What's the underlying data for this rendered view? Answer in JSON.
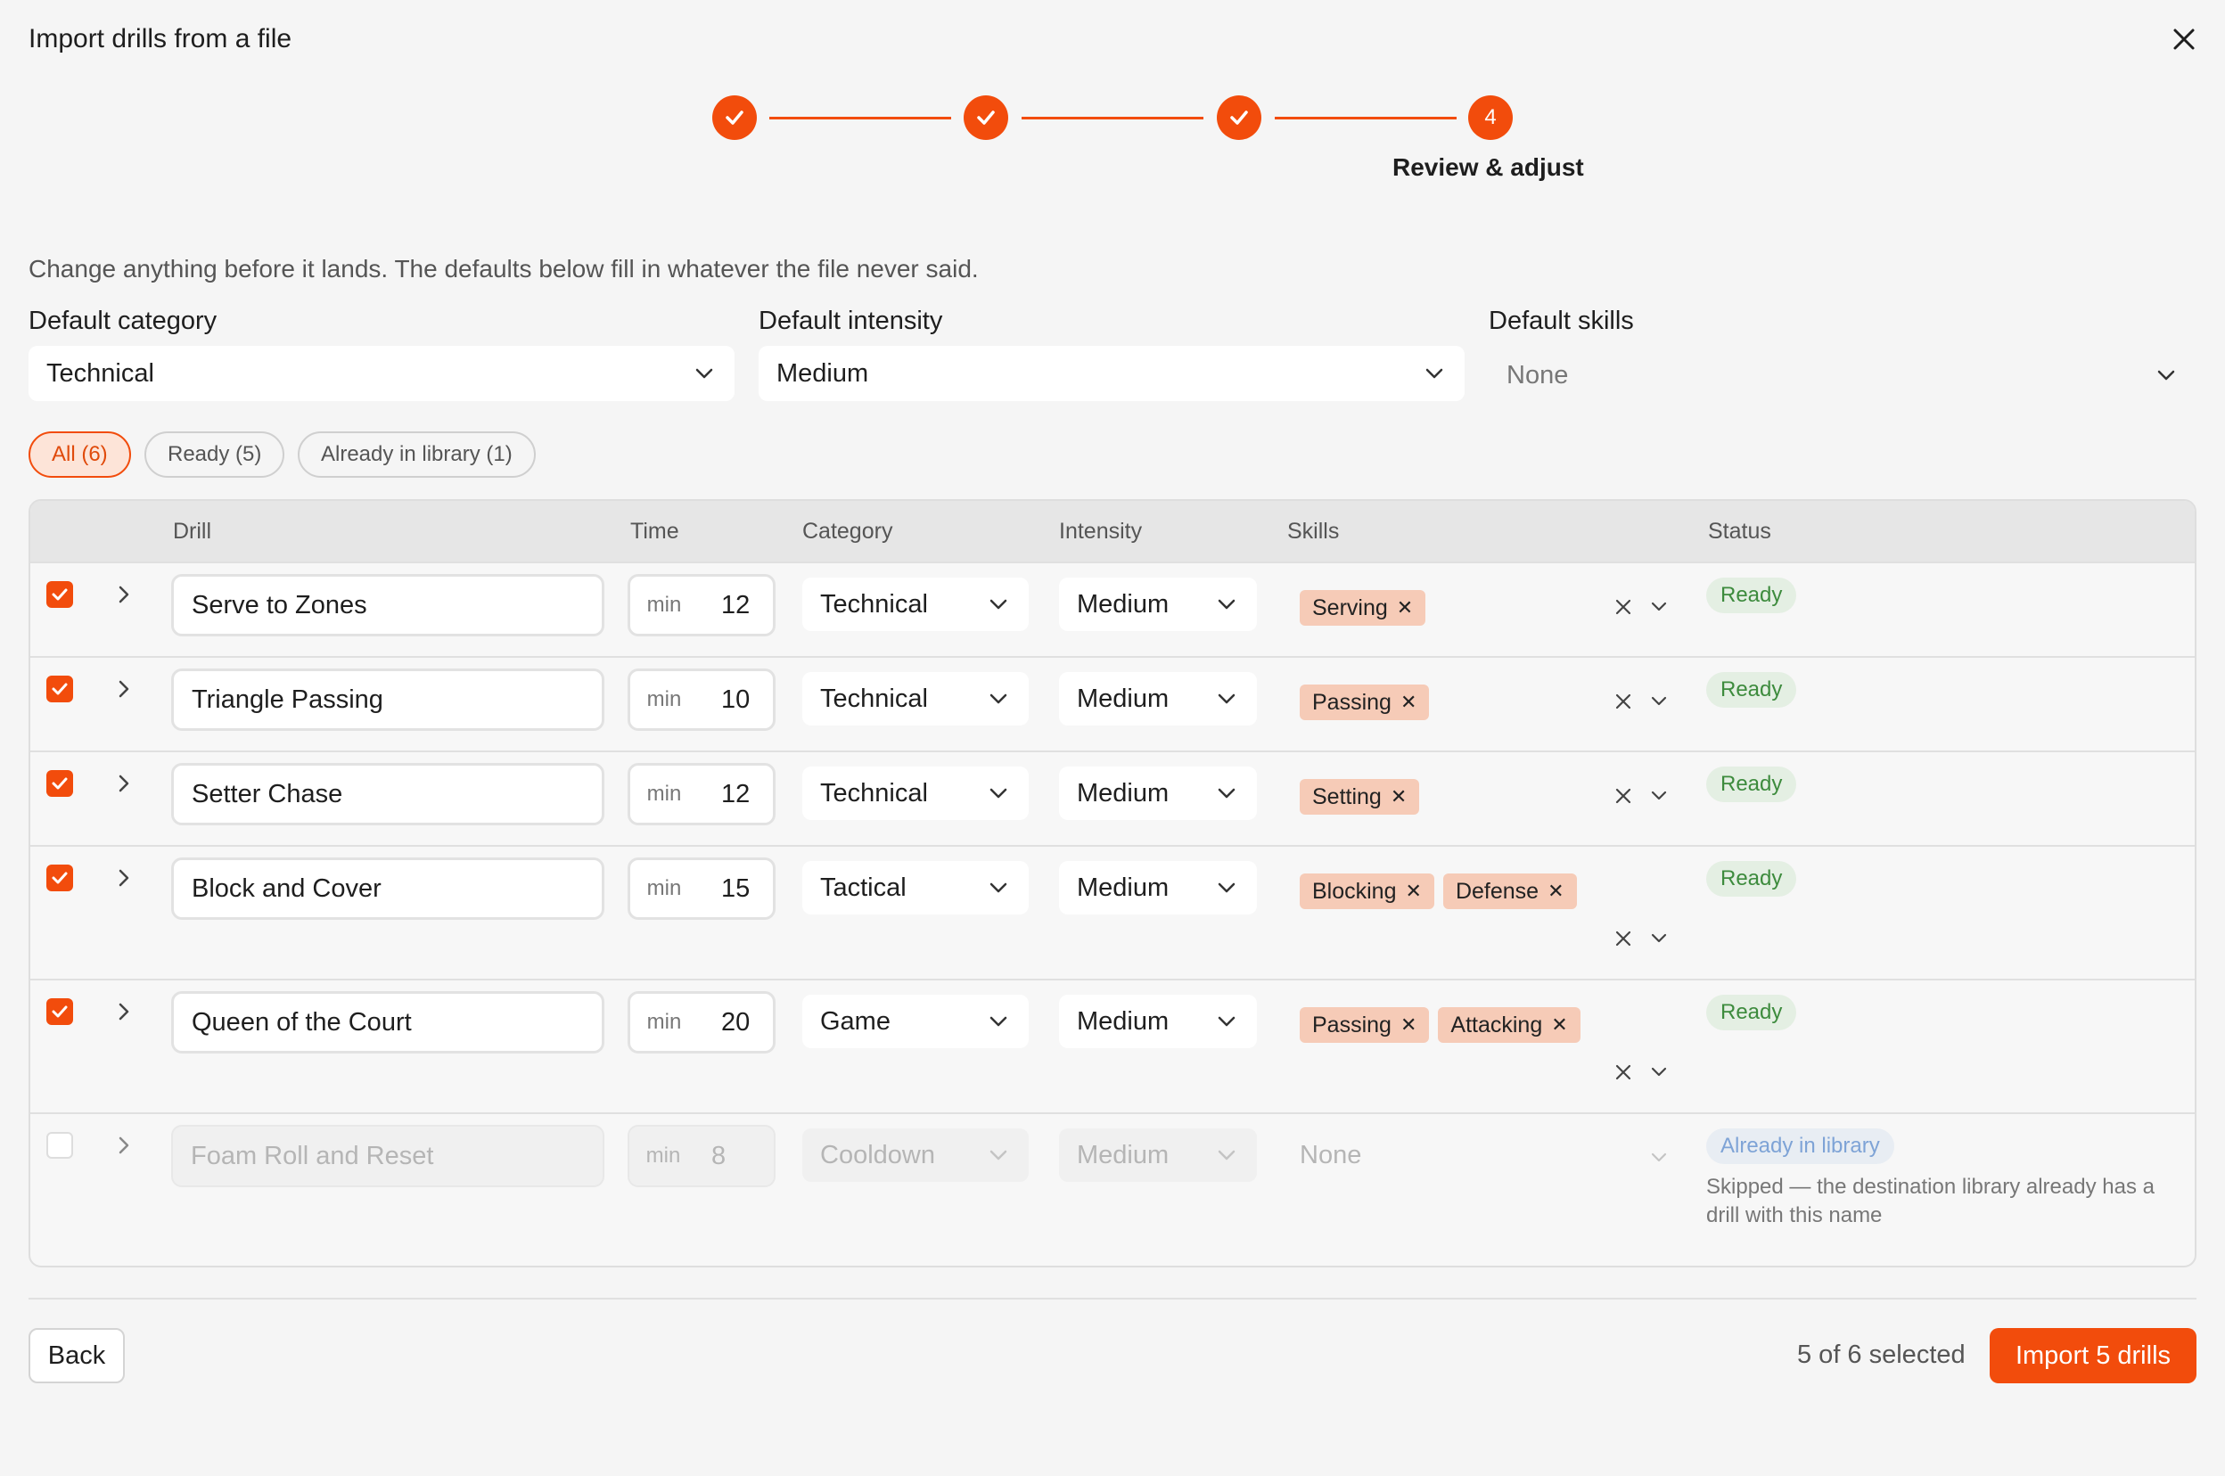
{
  "dialog": {
    "title": "Import drills from a file"
  },
  "stepper": {
    "current_number": "4",
    "current_label": "Review & adjust"
  },
  "intro": "Change anything before it lands. The defaults below fill in whatever the file never said.",
  "defaults": {
    "category": {
      "label": "Default category",
      "value": "Technical"
    },
    "intensity": {
      "label": "Default intensity",
      "value": "Medium"
    },
    "skills": {
      "label": "Default skills",
      "value": "None"
    }
  },
  "filters": [
    "All (6)",
    "Ready (5)",
    "Already in library (1)"
  ],
  "table": {
    "headers": {
      "drill": "Drill",
      "time": "Time",
      "category": "Category",
      "intensity": "Intensity",
      "skills": "Skills",
      "status": "Status"
    },
    "time_unit": "min",
    "rows": [
      {
        "name": "Serve to Zones",
        "time": "12",
        "category": "Technical",
        "intensity": "Medium",
        "skills": [
          "Serving"
        ],
        "status": "Ready",
        "checked": true
      },
      {
        "name": "Triangle Passing",
        "time": "10",
        "category": "Technical",
        "intensity": "Medium",
        "skills": [
          "Passing"
        ],
        "status": "Ready",
        "checked": true
      },
      {
        "name": "Setter Chase",
        "time": "12",
        "category": "Technical",
        "intensity": "Medium",
        "skills": [
          "Setting"
        ],
        "status": "Ready",
        "checked": true
      },
      {
        "name": "Block and Cover",
        "time": "15",
        "category": "Tactical",
        "intensity": "Medium",
        "skills": [
          "Blocking",
          "Defense"
        ],
        "status": "Ready",
        "checked": true
      },
      {
        "name": "Queen of the Court",
        "time": "20",
        "category": "Game",
        "intensity": "Medium",
        "skills": [
          "Passing",
          "Attacking"
        ],
        "status": "Ready",
        "checked": true
      },
      {
        "name": "Foam Roll and Reset",
        "time": "8",
        "category": "Cooldown",
        "intensity": "Medium",
        "skills_placeholder": "None",
        "status": "Already in library",
        "note": "Skipped — the destination library already has a drill with this name",
        "checked": false
      }
    ]
  },
  "footer": {
    "back": "Back",
    "selected": "5 of 6 selected",
    "import": "Import 5 drills"
  },
  "colors": {
    "accent": "#f24c0c",
    "ready": "#3d8b3d",
    "library": "#7ea3d6"
  }
}
